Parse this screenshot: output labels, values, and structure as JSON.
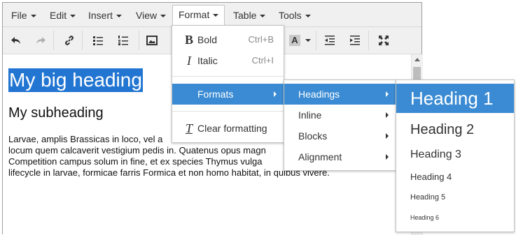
{
  "menubar": {
    "items": [
      "File",
      "Edit",
      "Insert",
      "View",
      "Format",
      "Table",
      "Tools"
    ]
  },
  "toolbar": {
    "buttons": [
      "undo-icon",
      "redo-icon",
      "link-icon",
      "bullet-list-icon",
      "numbered-list-icon",
      "image-icon",
      "background-color-icon",
      "outdent-icon",
      "indent-icon",
      "fullscreen-icon"
    ],
    "bg_color_letter": "A"
  },
  "content": {
    "heading1": "My big heading",
    "heading2": "My subheading",
    "paragraph": "Larvae, amplis Brassicas in loco, vel a\nlocum quem calcaverit vestigium pedis in. Quatenus opus magn\nCompetition campus solum in fine, et ex species Thymus vulga\nlifecycle in larvae, formicae farris Formica et non homo habitat, in quibus vivere."
  },
  "format_menu": {
    "bold": {
      "icon": "B",
      "label": "Bold",
      "shortcut": "Ctrl+B"
    },
    "italic": {
      "icon": "I",
      "label": "Italic",
      "shortcut": "Ctrl+I"
    },
    "formats": {
      "label": "Formats"
    },
    "clear": {
      "icon": "T",
      "label": "Clear formatting"
    }
  },
  "formats_submenu": [
    "Headings",
    "Inline",
    "Blocks",
    "Alignment"
  ],
  "headings_submenu": [
    "Heading 1",
    "Heading 2",
    "Heading 3",
    "Heading 4",
    "Heading 5",
    "Heading 6"
  ],
  "colors": {
    "accent": "#3a8bd3",
    "selection": "#2276d2",
    "menubar_bg": "#f0f0f0"
  }
}
